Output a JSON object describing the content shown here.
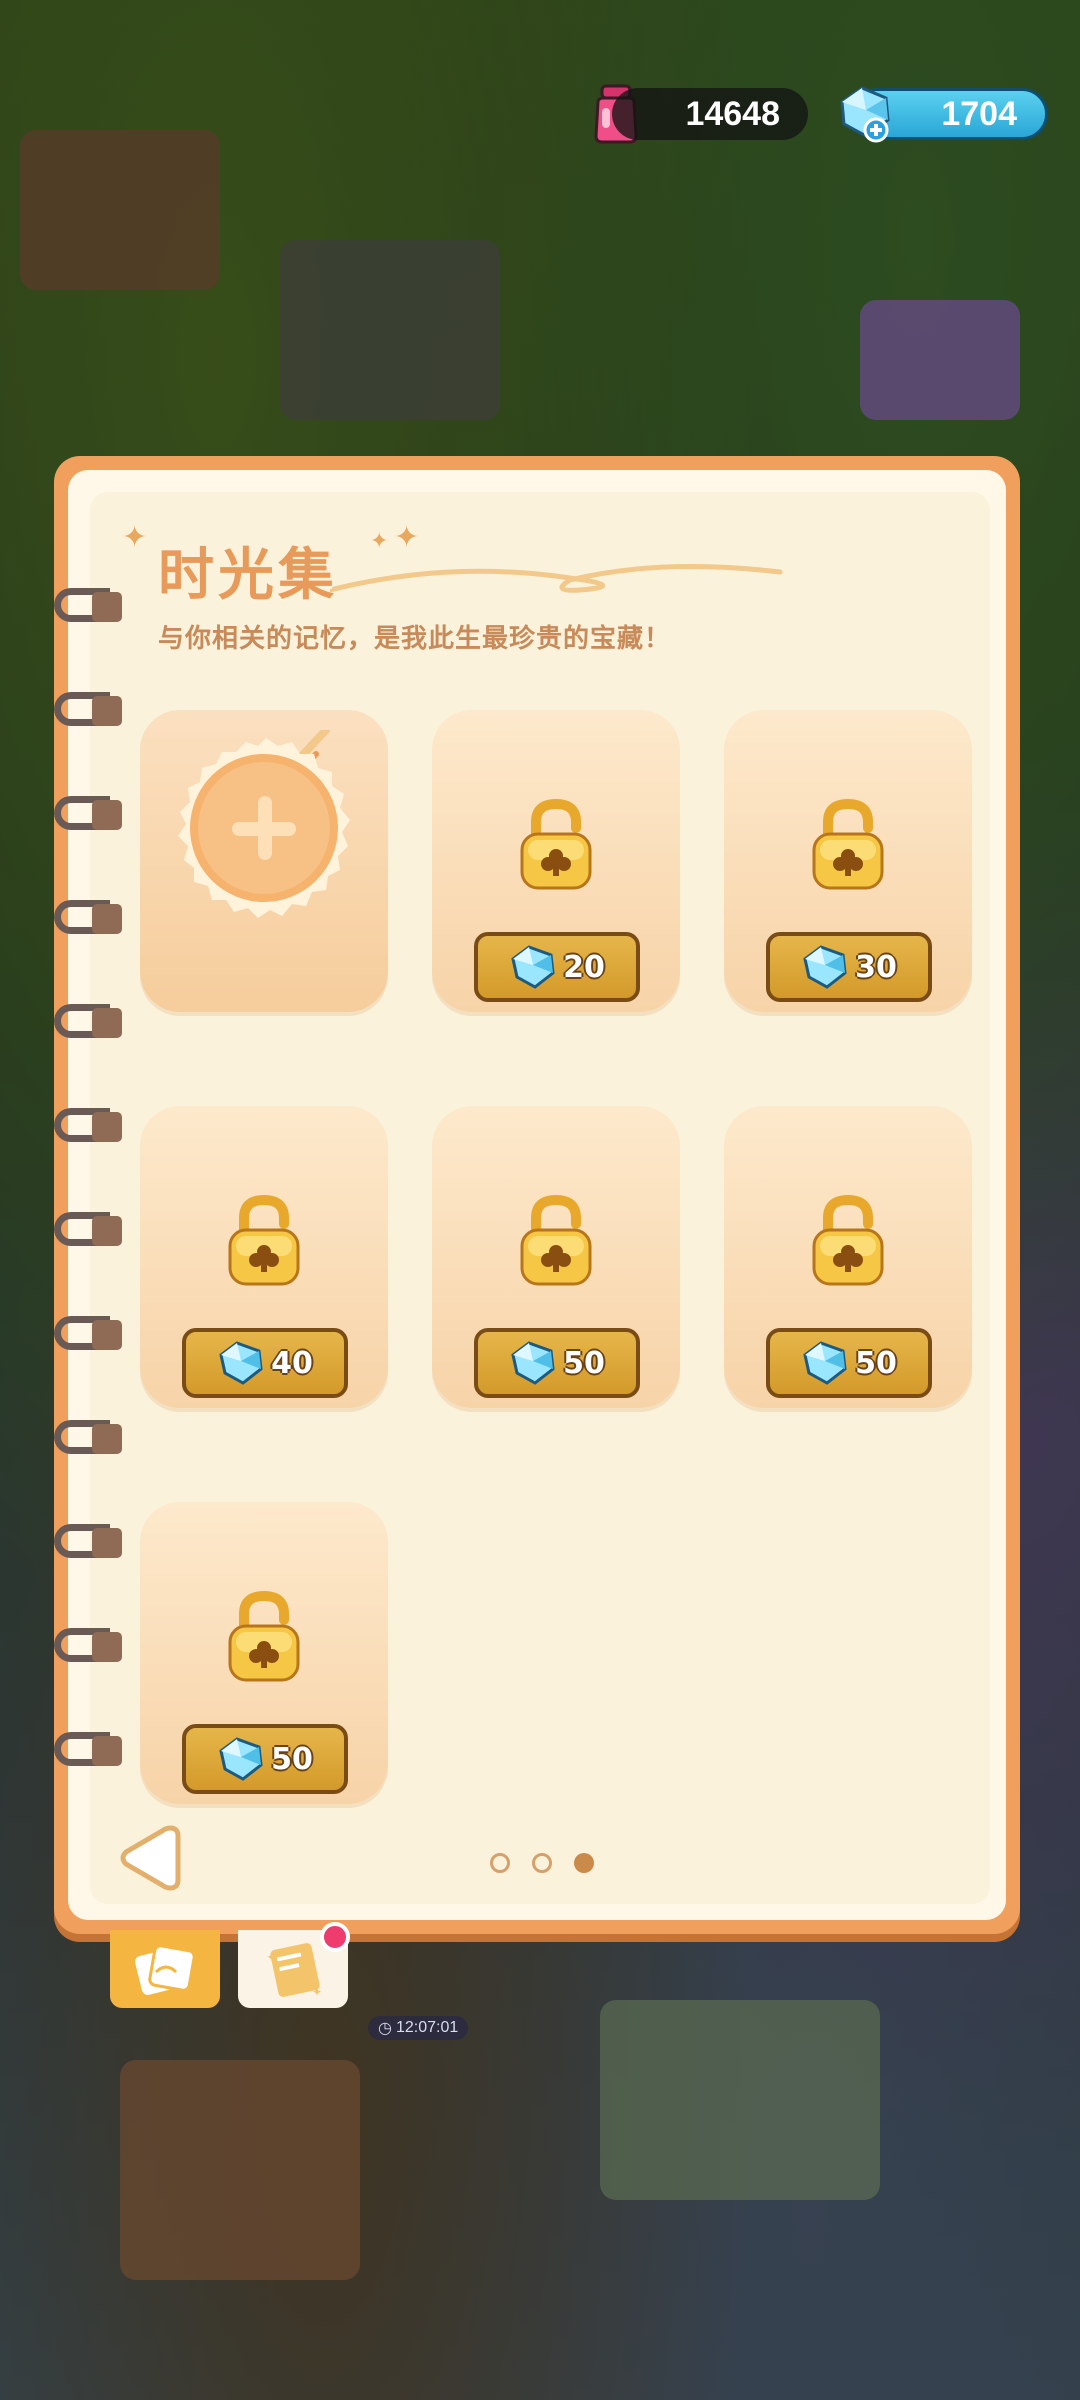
{
  "hud": {
    "ink_count": "14648",
    "gem_count": "1704"
  },
  "panel": {
    "title": "时光集",
    "subtitle": "与你相关的记忆，是我此生最珍贵的宝藏！"
  },
  "slots": [
    {
      "type": "add"
    },
    {
      "type": "locked",
      "price": "20"
    },
    {
      "type": "locked",
      "price": "30"
    },
    {
      "type": "locked",
      "price": "40"
    },
    {
      "type": "locked",
      "price": "50"
    },
    {
      "type": "locked",
      "price": "50"
    },
    {
      "type": "locked",
      "price": "50"
    }
  ],
  "pagination": {
    "total": 3,
    "current": 3
  },
  "timer": "12:07:01",
  "colors": {
    "panel_border": "#f0a05c",
    "price_button": "#d9a437",
    "accent_title": "#e89a5a"
  }
}
